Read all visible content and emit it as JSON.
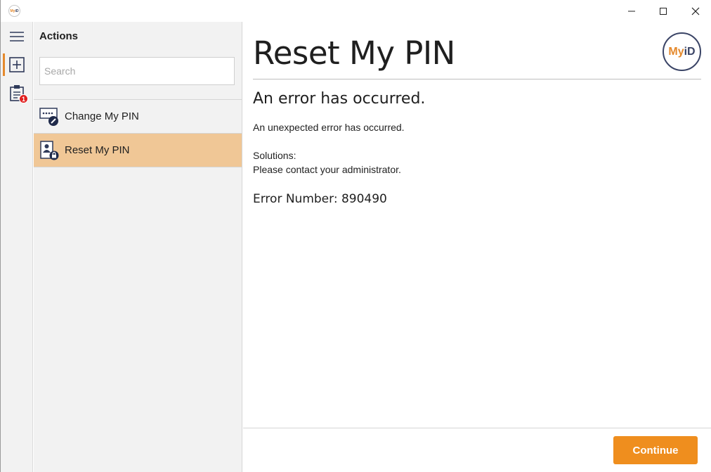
{
  "window": {
    "app_icon_text_my": "My",
    "app_icon_text_id": "iD"
  },
  "sidebar": {
    "menu_icon": "hamburger-icon",
    "items": [
      {
        "icon": "add-square-icon",
        "active": true
      },
      {
        "icon": "clipboard-icon",
        "badge": "1"
      }
    ]
  },
  "actions": {
    "title": "Actions",
    "search_placeholder": "Search",
    "search_value": "",
    "items": [
      {
        "label": "Change My PIN",
        "icon": "change-pin-icon",
        "selected": false
      },
      {
        "label": "Reset My PIN",
        "icon": "reset-pin-icon",
        "selected": true
      }
    ]
  },
  "main": {
    "title": "Reset My PIN",
    "logo_my": "My",
    "logo_id": "iD",
    "error_heading": "An error has occurred.",
    "error_text": "An unexpected error has occurred.",
    "solutions_label": "Solutions:",
    "solutions_text": "Please contact your administrator.",
    "error_number": "Error Number: 890490"
  },
  "footer": {
    "continue_label": "Continue"
  },
  "colors": {
    "accent": "#ef8e1e",
    "selected_row": "#f0c796",
    "brand_navy": "#3a4466",
    "badge": "#e01e1e"
  }
}
